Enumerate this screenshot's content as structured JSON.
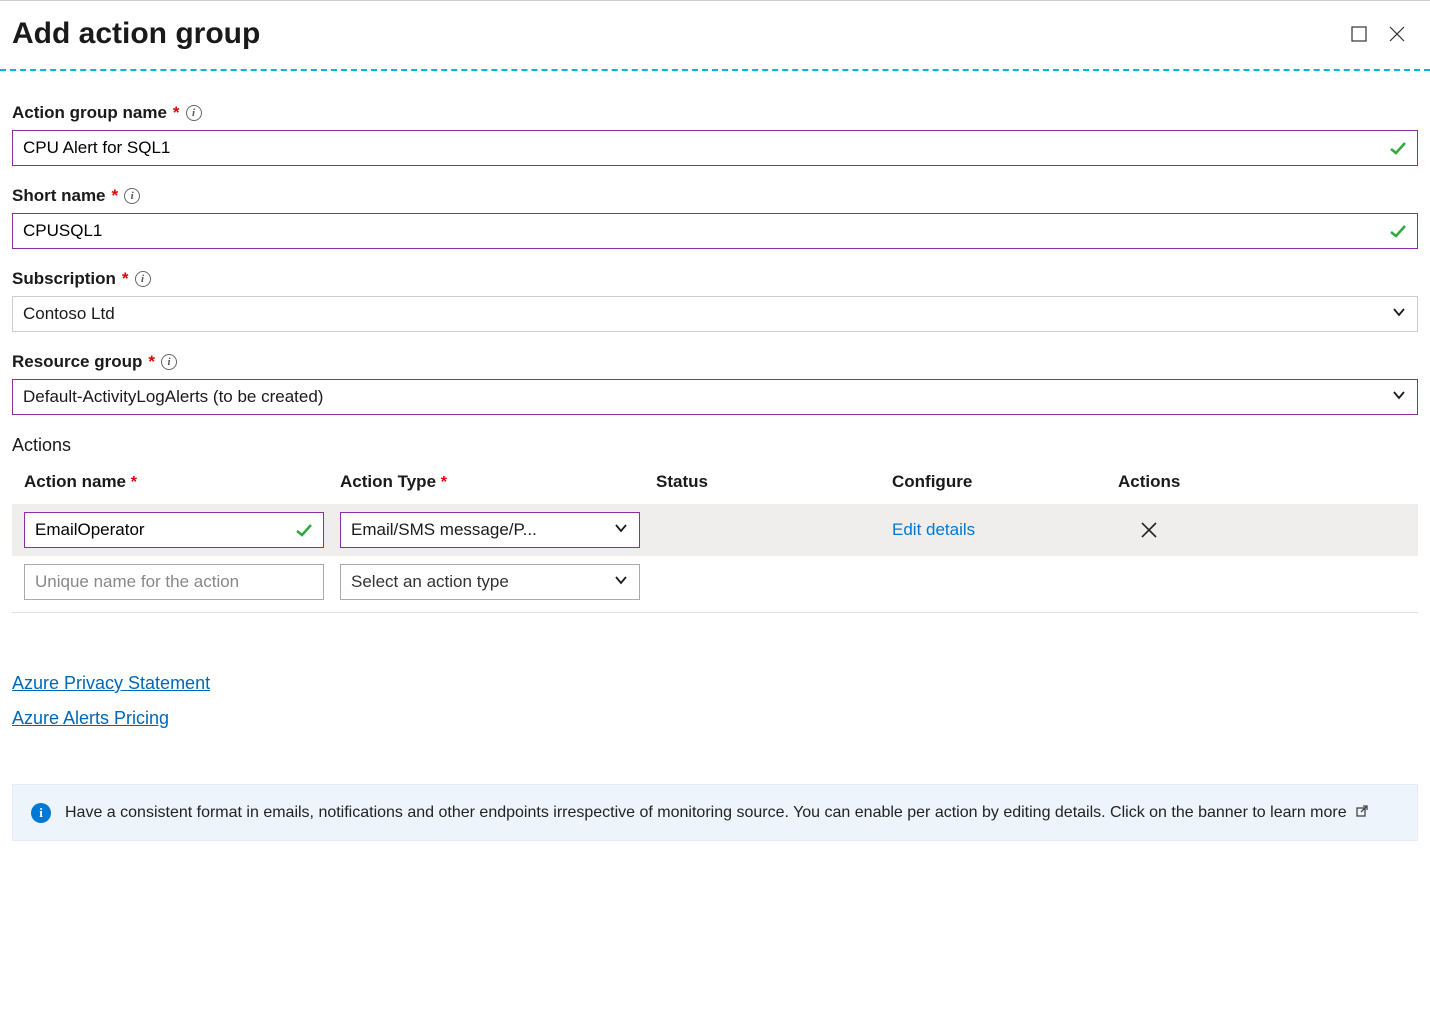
{
  "header": {
    "title": "Add action group"
  },
  "fields": {
    "action_group_name": {
      "label": "Action group name",
      "value": "CPU Alert for SQL1"
    },
    "short_name": {
      "label": "Short name",
      "value": "CPUSQL1"
    },
    "subscription": {
      "label": "Subscription",
      "value": "Contoso Ltd"
    },
    "resource_group": {
      "label": "Resource group",
      "value": "Default-ActivityLogAlerts (to be created)"
    }
  },
  "actions_section": {
    "label": "Actions",
    "columns": {
      "action_name": "Action name",
      "action_type": "Action Type",
      "status": "Status",
      "configure": "Configure",
      "actions": "Actions"
    },
    "rows": [
      {
        "name": "EmailOperator",
        "type": "Email/SMS message/P...",
        "status": "",
        "configure": "Edit details"
      }
    ],
    "blank_row": {
      "name_placeholder": "Unique name for the action",
      "type_placeholder": "Select an action type"
    }
  },
  "links": {
    "privacy": "Azure Privacy Statement",
    "pricing": "Azure Alerts Pricing"
  },
  "banner": {
    "text": "Have a consistent format in emails, notifications and other endpoints irrespective of monitoring source. You can enable per action by editing details. Click on the banner to learn more"
  }
}
